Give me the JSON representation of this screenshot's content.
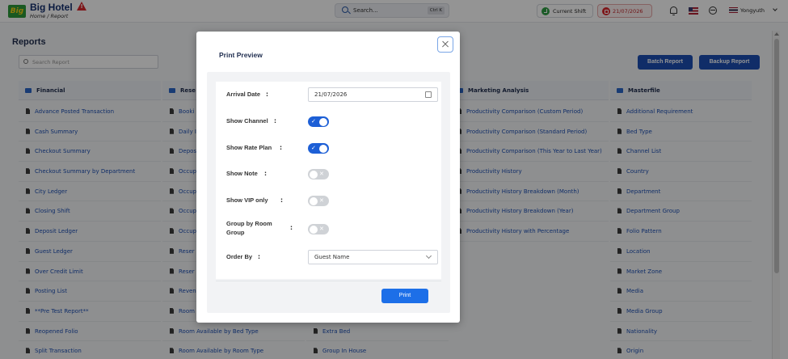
{
  "app": {
    "logo_text": "Big",
    "brand": "Big Hotel",
    "breadcrumb": "Home / Report"
  },
  "topbar": {
    "search_placeholder": "Search...",
    "search_shortcut": "Ctrl K",
    "shift_label": "Current Shift",
    "business_date": "21/07/2026",
    "user_name": "Yongyuth"
  },
  "page": {
    "title": "Reports",
    "search_placeholder": "Search Report",
    "batch_report_label": "Batch Report",
    "backup_report_label": "Backup Report"
  },
  "columns": [
    {
      "title": "Financial",
      "items": [
        "Advance Posted Transaction",
        "Cash Summary",
        "Checkout Summary",
        "Checkout Summary by Department",
        "City Ledger",
        "Closing Shift",
        "Deposit Ledger",
        "Guest Ledger",
        "Over Credit Limit",
        "Posting List",
        "**Pre Test Report**",
        "Reopened Folio",
        "Split Transaction"
      ]
    },
    {
      "title": "Rese",
      "items": [
        "Booki",
        "Daily I",
        "Depos",
        "Occup",
        "Occup",
        "Occup",
        "Occup",
        "Reser",
        "Reser",
        "Reven",
        "Room",
        "Room Available by Bed Type",
        "Room Available by Room Type"
      ]
    },
    {
      "title": "",
      "items": [
        "",
        "",
        "",
        "",
        "",
        "",
        "",
        "",
        "",
        "",
        "",
        "Extra Bed",
        "Group In House"
      ]
    },
    {
      "title": "Marketing Analysis",
      "items": [
        "Productivity Comparison (Custom Period)",
        "Productivity Comparison (Standard Period)",
        "Productivity Comparison (This Year to Last Year)",
        "Productivity History",
        "Productivity History Breakdown (Month)",
        "Productivity History Breakdown (Year)",
        "Productivity History with Percentage"
      ]
    },
    {
      "title": "Masterfile",
      "items": [
        "Additional Requirement",
        "Bed Type",
        "Channel List",
        "Country",
        "Department",
        "Department Group",
        "Folio Pattern",
        "Location",
        "Market Zone",
        "Media",
        "Media Group",
        "Nationality",
        "Origin"
      ]
    }
  ],
  "modal": {
    "title": "Print Preview",
    "fields": {
      "arrival_date_label": "Arrival Date",
      "arrival_date_value": "21/07/2026",
      "show_channel_label": "Show Channel",
      "show_channel_on": true,
      "show_rate_plan_label": "Show Rate Plan",
      "show_rate_plan_on": true,
      "show_note_label": "Show Note",
      "show_note_on": false,
      "show_vip_label": "Show VIP only",
      "show_vip_on": false,
      "group_by_room_group_label": "Group by Room Group",
      "group_by_room_group_on": false,
      "order_by_label": "Order By",
      "order_by_value": "Guest Name"
    },
    "colon": ":",
    "print_label": "Print"
  },
  "colors": {
    "primary": "#1c4fb3",
    "toggle_on": "#1d5fd6",
    "toggle_off": "#cfd2d6",
    "print_button": "#1d6fe8",
    "date_alert": "#d9262b",
    "shift_ok": "#2f9e44"
  }
}
